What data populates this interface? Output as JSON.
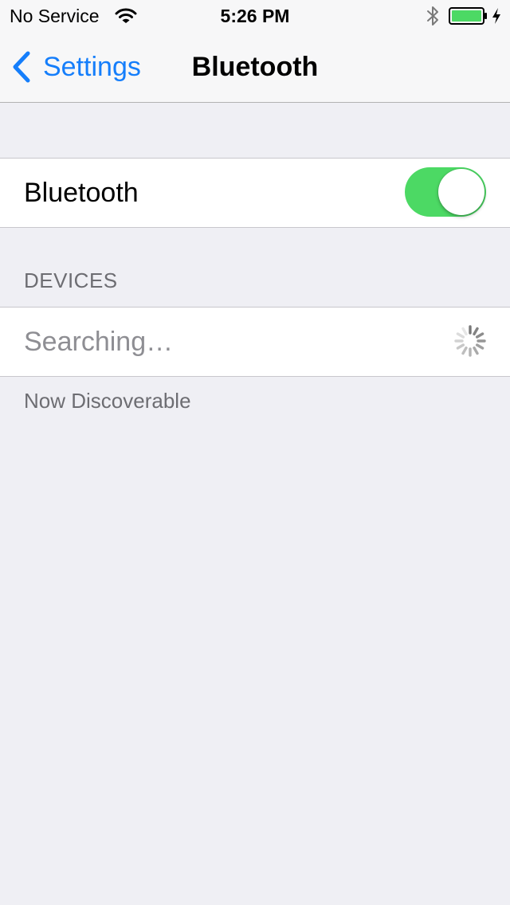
{
  "status_bar": {
    "carrier": "No Service",
    "time": "5:26 PM",
    "battery_color": "#4cd964",
    "icons": [
      "wifi-icon",
      "bluetooth-icon",
      "battery-icon",
      "charging-bolt-icon"
    ]
  },
  "nav": {
    "back_label": "Settings",
    "title": "Bluetooth",
    "accent_color": "#157efb"
  },
  "bluetooth_row": {
    "label": "Bluetooth",
    "toggle_on": true,
    "toggle_color": "#4cd964"
  },
  "devices": {
    "header": "DEVICES",
    "status_label": "Searching…",
    "status_icon": "activity-spinner-icon"
  },
  "footer": {
    "text": "Now Discoverable"
  }
}
